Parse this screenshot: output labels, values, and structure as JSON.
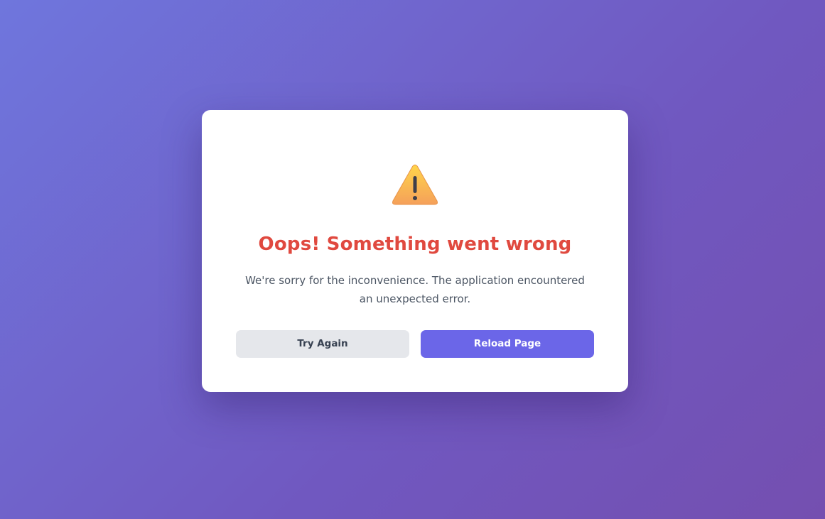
{
  "error_dialog": {
    "icon": "warning-triangle-icon",
    "title": "Oops! Something went wrong",
    "message": "We're sorry for the inconvenience. The application encountered an unexpected error.",
    "buttons": {
      "try_again_label": "Try Again",
      "reload_label": "Reload Page"
    }
  },
  "colors": {
    "background_start": "#6f76dd",
    "background_end": "#744fb0",
    "title": "#e0493f",
    "primary_button": "#6b66e8",
    "secondary_button": "#e5e7eb",
    "warning_icon": "#f6b04a"
  }
}
